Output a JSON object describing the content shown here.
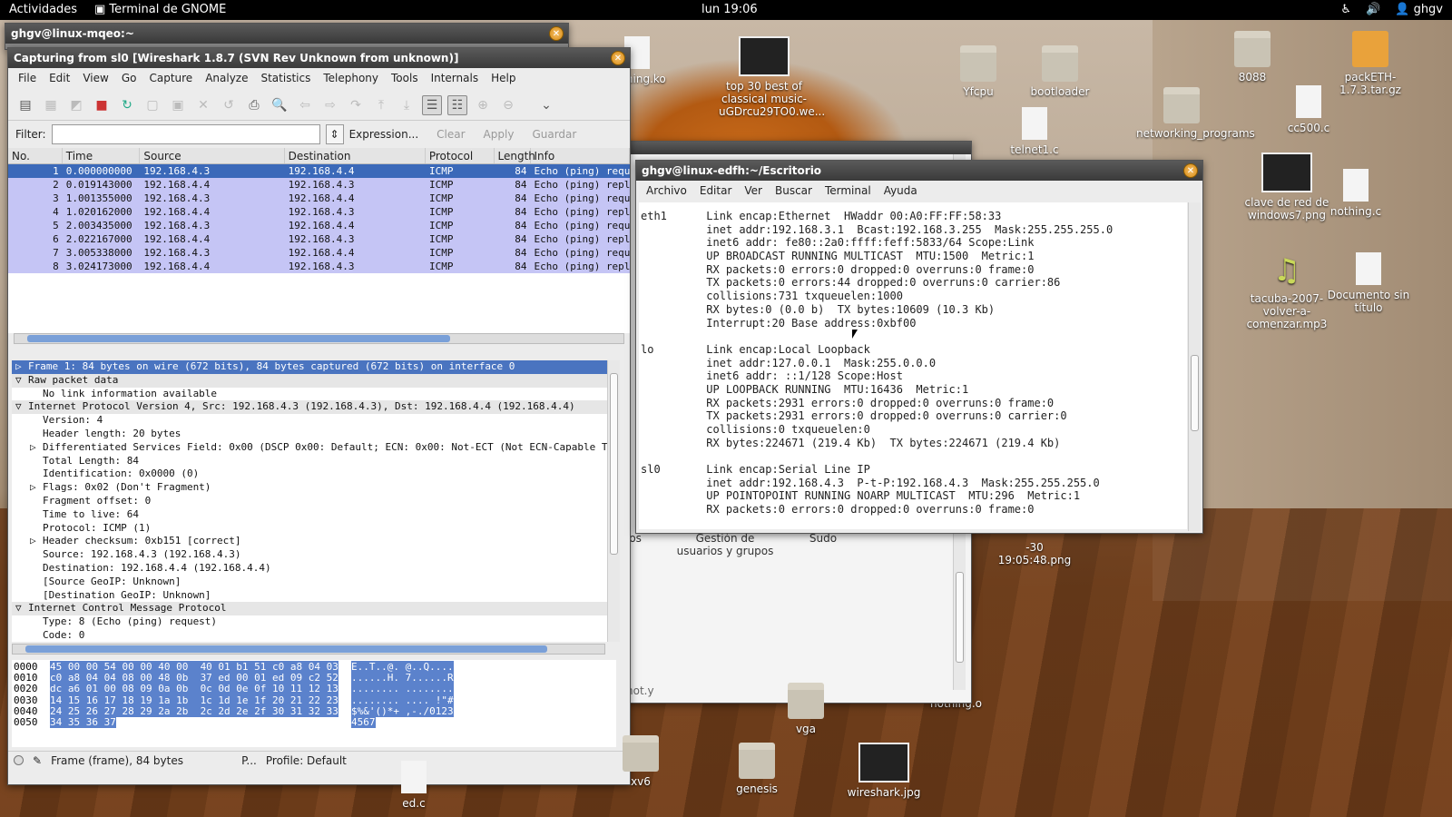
{
  "topbar": {
    "activities": "Actividades",
    "app": "Terminal de GNOME",
    "clock": "lun 19:06",
    "user": "ghgv",
    "accessibility_icon": "accessibility-icon",
    "volume_icon": "volume-icon"
  },
  "desktop": {
    "icons": [
      {
        "label": "nothing.ko",
        "kind": "doc"
      },
      {
        "label": "top 30 best of classical music-uGDrcu29TO0.we...",
        "kind": "thumb"
      },
      {
        "label": "Yfcpu",
        "kind": "folder"
      },
      {
        "label": "bootloader",
        "kind": "folder"
      },
      {
        "label": "8088",
        "kind": "folder"
      },
      {
        "label": "packETH-1.7.3.tar.gz",
        "kind": "archive"
      },
      {
        "label": "networking_programs",
        "kind": "folder"
      },
      {
        "label": "telnet1.c",
        "kind": "doc"
      },
      {
        "label": "cc500.c",
        "kind": "doc"
      },
      {
        "label": "clave de red de windows7.png",
        "kind": "thumb"
      },
      {
        "label": "nothing.c",
        "kind": "doc"
      },
      {
        "label": "tacuba-2007-volver-a-comenzar.mp3",
        "kind": "music"
      },
      {
        "label": "Documento sin título",
        "kind": "doc"
      },
      {
        "label": "xv6",
        "kind": "folder"
      },
      {
        "label": "genesis",
        "kind": "folder"
      },
      {
        "label": "wireshark.jpg",
        "kind": "thumb"
      },
      {
        "label": "vga",
        "kind": "folder"
      },
      {
        "label": "ed.c",
        "kind": "doc"
      }
    ]
  },
  "bg_window": {
    "title": "ghgv@linux-mqeo:~"
  },
  "behind_window": {
    "items": [
      "jos",
      "Gestión de usuarios y grupos",
      "Sudo",
      "-30 19:05:48.png",
      "hot.y",
      "nothing.o"
    ]
  },
  "wireshark": {
    "title": "Capturing from sl0   [Wireshark 1.8.7  (SVN Rev Unknown from unknown)]",
    "menu": [
      "File",
      "Edit",
      "View",
      "Go",
      "Capture",
      "Analyze",
      "Statistics",
      "Telephony",
      "Tools",
      "Internals",
      "Help"
    ],
    "filter": {
      "label": "Filter:",
      "value": "",
      "expression": "Expression...",
      "clear": "Clear",
      "apply": "Apply",
      "save": "Guardar"
    },
    "columns": [
      "No.",
      "Time",
      "Source",
      "Destination",
      "Protocol",
      "Length",
      "Info"
    ],
    "packets": [
      {
        "no": "1",
        "time": "0.000000000",
        "src": "192.168.4.3",
        "dst": "192.168.4.4",
        "proto": "ICMP",
        "len": "84",
        "info": "Echo (ping) request"
      },
      {
        "no": "2",
        "time": "0.019143000",
        "src": "192.168.4.4",
        "dst": "192.168.4.3",
        "proto": "ICMP",
        "len": "84",
        "info": "Echo (ping) reply"
      },
      {
        "no": "3",
        "time": "1.001355000",
        "src": "192.168.4.3",
        "dst": "192.168.4.4",
        "proto": "ICMP",
        "len": "84",
        "info": "Echo (ping) request"
      },
      {
        "no": "4",
        "time": "1.020162000",
        "src": "192.168.4.4",
        "dst": "192.168.4.3",
        "proto": "ICMP",
        "len": "84",
        "info": "Echo (ping) reply"
      },
      {
        "no": "5",
        "time": "2.003435000",
        "src": "192.168.4.3",
        "dst": "192.168.4.4",
        "proto": "ICMP",
        "len": "84",
        "info": "Echo (ping) request"
      },
      {
        "no": "6",
        "time": "2.022167000",
        "src": "192.168.4.4",
        "dst": "192.168.4.3",
        "proto": "ICMP",
        "len": "84",
        "info": "Echo (ping) reply"
      },
      {
        "no": "7",
        "time": "3.005338000",
        "src": "192.168.4.3",
        "dst": "192.168.4.4",
        "proto": "ICMP",
        "len": "84",
        "info": "Echo (ping) request"
      },
      {
        "no": "8",
        "time": "3.024173000",
        "src": "192.168.4.4",
        "dst": "192.168.4.3",
        "proto": "ICMP",
        "len": "84",
        "info": "Echo (ping) reply"
      }
    ],
    "details": [
      {
        "t": "Frame 1: 84 bytes on wire (672 bits), 84 bytes captured (672 bits) on interface 0",
        "e": "▷",
        "ind": 0,
        "cls": "hl"
      },
      {
        "t": "Raw packet data",
        "e": "▽",
        "ind": 0,
        "cls": "sec"
      },
      {
        "t": "No link information available",
        "e": "",
        "ind": 1,
        "cls": ""
      },
      {
        "t": "Internet Protocol Version 4, Src: 192.168.4.3 (192.168.4.3), Dst: 192.168.4.4 (192.168.4.4)",
        "e": "▽",
        "ind": 0,
        "cls": "sec"
      },
      {
        "t": "Version: 4",
        "e": "",
        "ind": 1,
        "cls": ""
      },
      {
        "t": "Header length: 20 bytes",
        "e": "",
        "ind": 1,
        "cls": ""
      },
      {
        "t": "Differentiated Services Field: 0x00 (DSCP 0x00: Default; ECN: 0x00: Not-ECT (Not ECN-Capable Tr",
        "e": "▷",
        "ind": 1,
        "cls": ""
      },
      {
        "t": "Total Length: 84",
        "e": "",
        "ind": 1,
        "cls": ""
      },
      {
        "t": "Identification: 0x0000 (0)",
        "e": "",
        "ind": 1,
        "cls": ""
      },
      {
        "t": "Flags: 0x02 (Don't Fragment)",
        "e": "▷",
        "ind": 1,
        "cls": ""
      },
      {
        "t": "Fragment offset: 0",
        "e": "",
        "ind": 1,
        "cls": ""
      },
      {
        "t": "Time to live: 64",
        "e": "",
        "ind": 1,
        "cls": ""
      },
      {
        "t": "Protocol: ICMP (1)",
        "e": "",
        "ind": 1,
        "cls": ""
      },
      {
        "t": "Header checksum: 0xb151 [correct]",
        "e": "▷",
        "ind": 1,
        "cls": ""
      },
      {
        "t": "Source: 192.168.4.3 (192.168.4.3)",
        "e": "",
        "ind": 1,
        "cls": ""
      },
      {
        "t": "Destination: 192.168.4.4 (192.168.4.4)",
        "e": "",
        "ind": 1,
        "cls": ""
      },
      {
        "t": "[Source GeoIP: Unknown]",
        "e": "",
        "ind": 1,
        "cls": ""
      },
      {
        "t": "[Destination GeoIP: Unknown]",
        "e": "",
        "ind": 1,
        "cls": ""
      },
      {
        "t": "Internet Control Message Protocol",
        "e": "▽",
        "ind": 0,
        "cls": "sec"
      },
      {
        "t": "Type: 8 (Echo (ping) request)",
        "e": "",
        "ind": 1,
        "cls": ""
      },
      {
        "t": "Code: 0",
        "e": "",
        "ind": 1,
        "cls": ""
      }
    ],
    "hex": [
      {
        "off": "0000",
        "bytes": "45 00 00 54 00 00 40 00  40 01 b1 51 c0 a8 04 03",
        "ascii": "E..T..@. @..Q...."
      },
      {
        "off": "0010",
        "bytes": "c0 a8 04 04 08 00 48 0b  37 ed 00 01 ed 09 c2 52",
        "ascii": "......H. 7......R"
      },
      {
        "off": "0020",
        "bytes": "dc a6 01 00 08 09 0a 0b  0c 0d 0e 0f 10 11 12 13",
        "ascii": "........ ........"
      },
      {
        "off": "0030",
        "bytes": "14 15 16 17 18 19 1a 1b  1c 1d 1e 1f 20 21 22 23",
        "ascii": "........ .... !\"#"
      },
      {
        "off": "0040",
        "bytes": "24 25 26 27 28 29 2a 2b  2c 2d 2e 2f 30 31 32 33",
        "ascii": "$%&'()*+ ,-./0123"
      },
      {
        "off": "0050",
        "bytes": "34 35 36 37",
        "ascii": "4567"
      }
    ],
    "status": {
      "frame": "Frame (frame), 84 bytes",
      "packets": "P...",
      "profile": "Profile: Default"
    }
  },
  "terminal": {
    "title": "ghgv@linux-edfh:~/Escritorio",
    "menu": [
      "Archivo",
      "Editar",
      "Ver",
      "Buscar",
      "Terminal",
      "Ayuda"
    ],
    "lines": [
      "eth1      Link encap:Ethernet  HWaddr 00:A0:FF:FF:58:33",
      "          inet addr:192.168.3.1  Bcast:192.168.3.255  Mask:255.255.255.0",
      "          inet6 addr: fe80::2a0:ffff:feff:5833/64 Scope:Link",
      "          UP BROADCAST RUNNING MULTICAST  MTU:1500  Metric:1",
      "          RX packets:0 errors:0 dropped:0 overruns:0 frame:0",
      "          TX packets:0 errors:44 dropped:0 overruns:0 carrier:86",
      "          collisions:731 txqueuelen:1000",
      "          RX bytes:0 (0.0 b)  TX bytes:10609 (10.3 Kb)",
      "          Interrupt:20 Base address:0xbf00",
      "",
      "lo        Link encap:Local Loopback",
      "          inet addr:127.0.0.1  Mask:255.0.0.0",
      "          inet6 addr: ::1/128 Scope:Host",
      "          UP LOOPBACK RUNNING  MTU:16436  Metric:1",
      "          RX packets:2931 errors:0 dropped:0 overruns:0 frame:0",
      "          TX packets:2931 errors:0 dropped:0 overruns:0 carrier:0",
      "          collisions:0 txqueuelen:0",
      "          RX bytes:224671 (219.4 Kb)  TX bytes:224671 (219.4 Kb)",
      "",
      "sl0       Link encap:Serial Line IP",
      "          inet addr:192.168.4.3  P-t-P:192.168.4.3  Mask:255.255.255.0",
      "          UP POINTOPOINT RUNNING NOARP MULTICAST  MTU:296  Metric:1",
      "          RX packets:0 errors:0 dropped:0 overruns:0 frame:0"
    ]
  }
}
